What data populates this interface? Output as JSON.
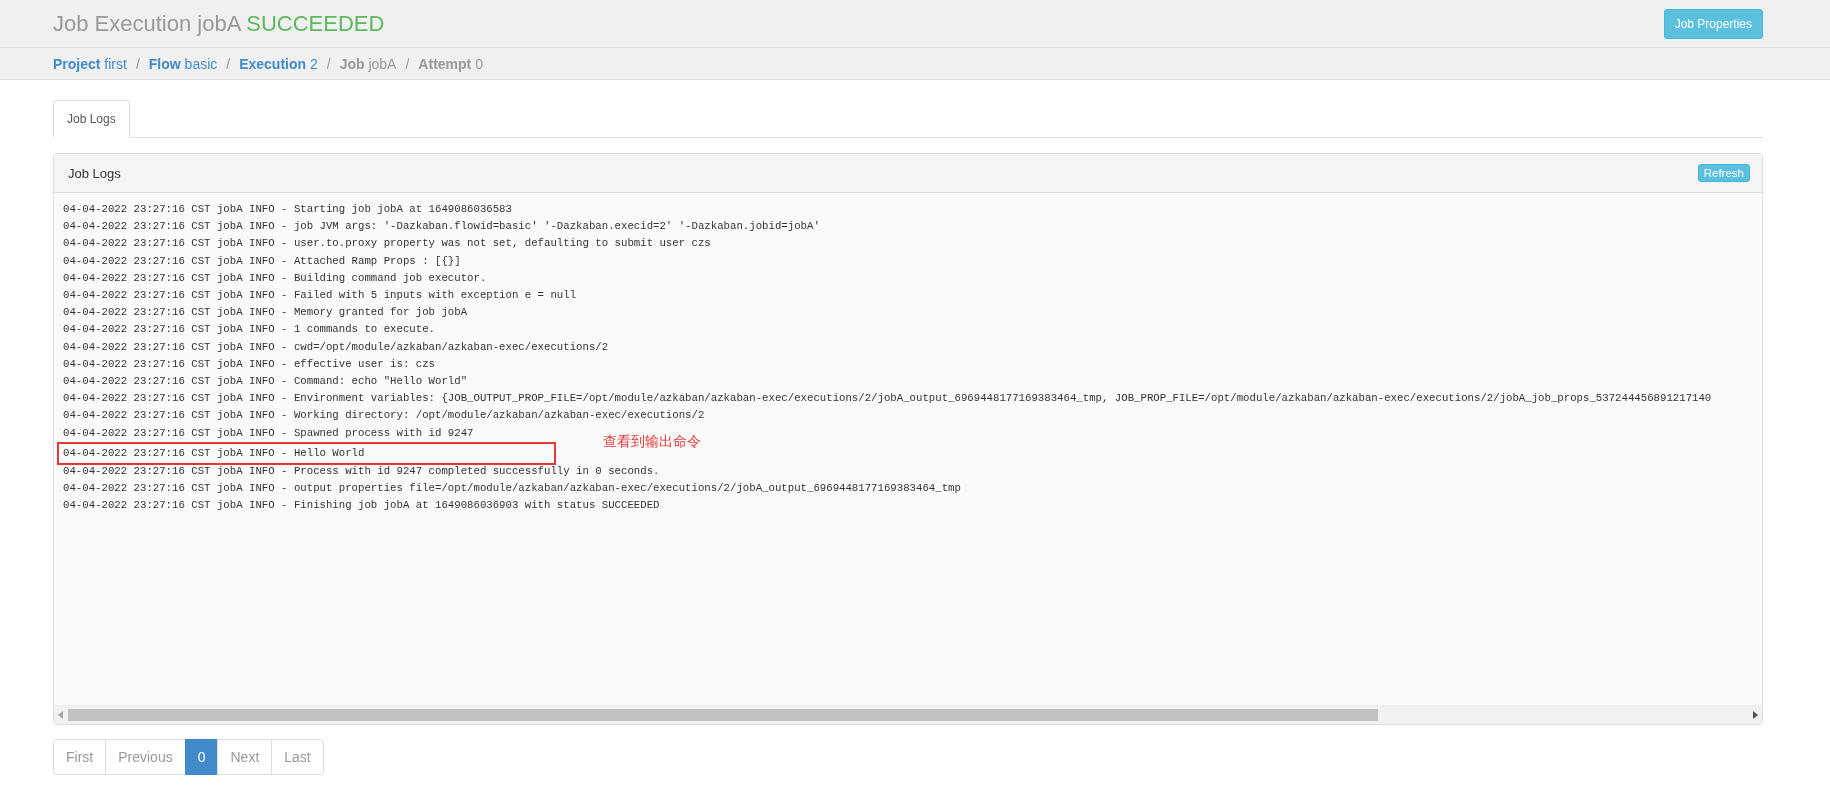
{
  "header": {
    "title": "Job Execution jobA",
    "status": "SUCCEEDED",
    "button": "Job Properties"
  },
  "breadcrumb": [
    {
      "label": "Project",
      "value": "first",
      "link": true
    },
    {
      "separator": "/",
      "label": "Flow",
      "value": "basic",
      "link": true
    },
    {
      "separator": "/",
      "label": "Execution",
      "value": "2",
      "link": true
    },
    {
      "separator": "/",
      "label": "Job",
      "value": "jobA",
      "link": false
    },
    {
      "separator": "/",
      "label": "Attempt",
      "value": "0",
      "link": false
    }
  ],
  "tabs": [
    {
      "label": "Job Logs",
      "selected": true
    }
  ],
  "panel": {
    "title": "Job Logs",
    "button": "Refresh"
  },
  "log_lines": [
    {
      "text": "04-04-2022 23:27:16 CST jobA INFO - Starting job jobA at 1649086036583",
      "highlighted": false
    },
    {
      "text": "04-04-2022 23:27:16 CST jobA INFO - job JVM args: '-Dazkaban.flowid=basic' '-Dazkaban.execid=2' '-Dazkaban.jobid=jobA'",
      "highlighted": false
    },
    {
      "text": "04-04-2022 23:27:16 CST jobA INFO - user.to.proxy property was not set, defaulting to submit user czs",
      "highlighted": false
    },
    {
      "text": "04-04-2022 23:27:16 CST jobA INFO - Attached Ramp Props : [{}]",
      "highlighted": false
    },
    {
      "text": "04-04-2022 23:27:16 CST jobA INFO - Building command job executor.",
      "highlighted": false
    },
    {
      "text": "04-04-2022 23:27:16 CST jobA INFO - Failed with 5 inputs with exception e = null",
      "highlighted": false
    },
    {
      "text": "04-04-2022 23:27:16 CST jobA INFO - Memory granted for job jobA",
      "highlighted": false
    },
    {
      "text": "04-04-2022 23:27:16 CST jobA INFO - 1 commands to execute.",
      "highlighted": false
    },
    {
      "text": "04-04-2022 23:27:16 CST jobA INFO - cwd=/opt/module/azkaban/azkaban-exec/executions/2",
      "highlighted": false
    },
    {
      "text": "04-04-2022 23:27:16 CST jobA INFO - effective user is: czs",
      "highlighted": false
    },
    {
      "text": "04-04-2022 23:27:16 CST jobA INFO - Command: echo \"Hello World\"",
      "highlighted": false
    },
    {
      "text": "04-04-2022 23:27:16 CST jobA INFO - Environment variables: {JOB_OUTPUT_PROP_FILE=/opt/module/azkaban/azkaban-exec/executions/2/jobA_output_6969448177169383464_tmp, JOB_PROP_FILE=/opt/module/azkaban/azkaban-exec/executions/2/jobA_job_props_537244456891217140",
      "highlighted": false
    },
    {
      "text": "04-04-2022 23:27:16 CST jobA INFO - Working directory: /opt/module/azkaban/azkaban-exec/executions/2",
      "highlighted": false
    },
    {
      "text": "04-04-2022 23:27:16 CST jobA INFO - Spawned process with id 9247",
      "highlighted": false
    },
    {
      "text": "04-04-2022 23:27:16 CST jobA INFO - Hello World",
      "highlighted": true
    },
    {
      "text": "04-04-2022 23:27:16 CST jobA INFO - Process with id 9247 completed successfully in 0 seconds.",
      "highlighted": false
    },
    {
      "text": "04-04-2022 23:27:16 CST jobA INFO - output properties file=/opt/module/azkaban/azkaban-exec/executions/2/jobA_output_6969448177169383464_tmp",
      "highlighted": false
    },
    {
      "text": "04-04-2022 23:27:16 CST jobA INFO - Finishing job jobA at 1649086036903 with status SUCCEEDED",
      "highlighted": false
    }
  ],
  "annotation": {
    "text": "查看到输出命令"
  },
  "pagination": [
    {
      "label": "First",
      "selected": false
    },
    {
      "label": "Previous",
      "selected": false
    },
    {
      "label": "0",
      "selected": true
    },
    {
      "label": "Next",
      "selected": false
    },
    {
      "label": "Last",
      "selected": false
    }
  ]
}
